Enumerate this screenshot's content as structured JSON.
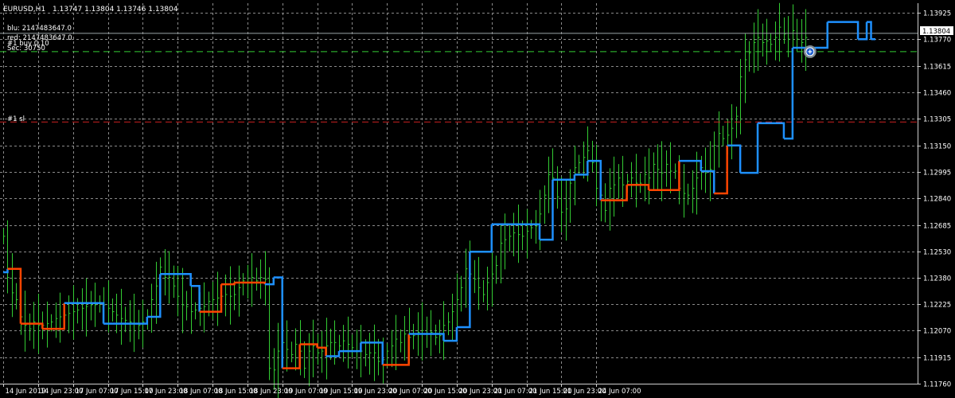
{
  "header": {
    "symbol": "EURUSD,H1",
    "ohlc": "1.13747 1.13804 1.13746 1.13804"
  },
  "indicator_labels": [
    "blu: 2147483647.0",
    "red: 2147483647.0",
    "#1 buy 0.10",
    "Sec: 30750"
  ],
  "sl_label": "#1 sl",
  "current_price_label": "1.13804",
  "colors": {
    "background": "#000000",
    "grid": "#8a8a8a",
    "axis_text": "#ffffff",
    "candle": "#33cc33",
    "step_up": "#1e90ff",
    "step_down": "#ff4500",
    "sl_line": "#cc2020",
    "price_line": "#33cc33",
    "bid_line": "#9aa5a8"
  },
  "chart_data": {
    "type": "line",
    "title": "EURUSD,H1",
    "y_ticks": [
      "1.13925",
      "1.13770",
      "1.13615",
      "1.13460",
      "1.13305",
      "1.13150",
      "1.12995",
      "1.12840",
      "1.12685",
      "1.12530",
      "1.12380",
      "1.12225",
      "1.12070",
      "1.11915",
      "1.11760"
    ],
    "x_ticks": [
      "14 Jun 2019",
      "14 Jun 23:00",
      "17 Jun 07:00",
      "17 Jun 15:00",
      "17 Jun 23:00",
      "18 Jun 07:00",
      "18 Jun 15:00",
      "18 Jun 23:00",
      "19 Jun 07:00",
      "19 Jun 15:00",
      "19 Jun 23:00",
      "20 Jun 07:00",
      "20 Jun 15:00",
      "20 Jun 23:00",
      "21 Jun 07:00",
      "21 Jun 15:00",
      "21 Jun 23:00",
      "24 Jun 07:00"
    ],
    "ylim": [
      1.1176,
      1.1398
    ],
    "grid": true,
    "current_price": 1.13804,
    "sl_price": 1.13287,
    "buy_price": 1.13697,
    "close": [
      1.1262,
      1.1238,
      1.1229,
      1.1225,
      1.1215,
      1.121,
      1.1208,
      1.1212,
      1.121,
      1.121,
      1.1211,
      1.1212,
      1.1214,
      1.1215,
      1.1216,
      1.1217,
      1.1218,
      1.1219,
      1.122,
      1.1221,
      1.1222,
      1.1222,
      1.1223,
      1.1222,
      1.122,
      1.1218,
      1.1216,
      1.1214,
      1.1213,
      1.1212,
      1.1211,
      1.121,
      1.1212,
      1.1215,
      1.1225,
      1.1233,
      1.1244,
      1.1238,
      1.1238,
      1.1233,
      1.1227,
      1.1222,
      1.1221,
      1.1218,
      1.1219,
      1.122,
      1.1221,
      1.1224,
      1.1225,
      1.1226,
      1.1227,
      1.1228,
      1.1227,
      1.1228,
      1.1232,
      1.1236,
      1.1235,
      1.1238,
      1.1236,
      1.1238,
      1.1237,
      1.1185,
      1.1184,
      1.1195,
      1.12,
      1.1196,
      1.1193,
      1.1199,
      1.1195,
      1.1185,
      1.1195,
      1.1198,
      1.1194,
      1.1195,
      1.1198,
      1.12,
      1.12,
      1.1198,
      1.1201,
      1.1199,
      1.1197,
      1.1195,
      1.1195,
      1.1193,
      1.1194,
      1.1194,
      1.1189,
      1.119,
      1.1195,
      1.1198,
      1.1202,
      1.12,
      1.1205,
      1.1203,
      1.1204,
      1.1206,
      1.1207,
      1.1205,
      1.1206,
      1.1203,
      1.1204,
      1.121,
      1.1212,
      1.1218,
      1.1225,
      1.1232,
      1.1243,
      1.124,
      1.1237,
      1.1232,
      1.1228,
      1.1235,
      1.124,
      1.1245,
      1.1258,
      1.126,
      1.1262,
      1.1264,
      1.1263,
      1.1262,
      1.1265,
      1.1267,
      1.1268,
      1.1275,
      1.1286,
      1.1298,
      1.1296,
      1.1285,
      1.1276,
      1.1278,
      1.1293,
      1.1302,
      1.1305,
      1.1308,
      1.1312,
      1.1305,
      1.129,
      1.1286,
      1.1277,
      1.129,
      1.1292,
      1.1296,
      1.1292,
      1.1294,
      1.1296,
      1.1293,
      1.1293,
      1.1298,
      1.1296,
      1.1304,
      1.1301,
      1.1299,
      1.1304,
      1.13,
      1.13,
      1.129,
      1.1287,
      1.1286,
      1.129,
      1.1296,
      1.1302,
      1.1299,
      1.1301,
      1.1315,
      1.1322,
      1.1319,
      1.1321,
      1.1325,
      1.1332,
      1.1355,
      1.1365,
      1.1369,
      1.1375,
      1.1378,
      1.1375,
      1.1376,
      1.1374,
      1.1378,
      1.1384,
      1.138,
      1.1377,
      1.1382,
      1.1377,
      1.1375,
      1.1378
    ],
    "step_segments": [
      {
        "from": 0,
        "to": 1,
        "level": 1.1241,
        "color": "blue"
      },
      {
        "from": 1,
        "to": 4,
        "level": 1.1243,
        "color": "red"
      },
      {
        "from": 4,
        "to": 9,
        "level": 1.1211,
        "color": "red"
      },
      {
        "from": 9,
        "to": 14,
        "level": 1.1208,
        "color": "red"
      },
      {
        "from": 14,
        "to": 23,
        "level": 1.1223,
        "color": "blue"
      },
      {
        "from": 23,
        "to": 33,
        "level": 1.1211,
        "color": "blue"
      },
      {
        "from": 33,
        "to": 36,
        "level": 1.1215,
        "color": "blue"
      },
      {
        "from": 36,
        "to": 43,
        "level": 1.124,
        "color": "blue"
      },
      {
        "from": 43,
        "to": 45,
        "level": 1.1233,
        "color": "blue"
      },
      {
        "from": 45,
        "to": 50,
        "level": 1.1218,
        "color": "red"
      },
      {
        "from": 50,
        "to": 53,
        "level": 1.1234,
        "color": "red"
      },
      {
        "from": 53,
        "to": 60,
        "level": 1.1235,
        "color": "red"
      },
      {
        "from": 60,
        "to": 62,
        "level": 1.1234,
        "color": "blue"
      },
      {
        "from": 62,
        "to": 64,
        "level": 1.1238,
        "color": "blue"
      },
      {
        "from": 64,
        "to": 68,
        "level": 1.1185,
        "color": "red"
      },
      {
        "from": 68,
        "to": 72,
        "level": 1.1199,
        "color": "red"
      },
      {
        "from": 72,
        "to": 74,
        "level": 1.1197,
        "color": "red"
      },
      {
        "from": 74,
        "to": 77,
        "level": 1.1192,
        "color": "blue"
      },
      {
        "from": 77,
        "to": 82,
        "level": 1.1195,
        "color": "blue"
      },
      {
        "from": 82,
        "to": 87,
        "level": 1.12,
        "color": "blue"
      },
      {
        "from": 87,
        "to": 93,
        "level": 1.1187,
        "color": "red"
      },
      {
        "from": 93,
        "to": 101,
        "level": 1.1205,
        "color": "blue"
      },
      {
        "from": 101,
        "to": 104,
        "level": 1.1201,
        "color": "blue"
      },
      {
        "from": 104,
        "to": 107,
        "level": 1.1209,
        "color": "blue"
      },
      {
        "from": 107,
        "to": 112,
        "level": 1.1253,
        "color": "blue"
      },
      {
        "from": 112,
        "to": 123,
        "level": 1.1269,
        "color": "blue"
      },
      {
        "from": 123,
        "to": 126,
        "level": 1.126,
        "color": "blue"
      },
      {
        "from": 126,
        "to": 131,
        "level": 1.1295,
        "color": "blue"
      },
      {
        "from": 131,
        "to": 134,
        "level": 1.1298,
        "color": "blue"
      },
      {
        "from": 134,
        "to": 137,
        "level": 1.1306,
        "color": "blue"
      },
      {
        "from": 137,
        "to": 143,
        "level": 1.1283,
        "color": "red"
      },
      {
        "from": 143,
        "to": 148,
        "level": 1.1292,
        "color": "red"
      },
      {
        "from": 148,
        "to": 155,
        "level": 1.1289,
        "color": "red"
      },
      {
        "from": 155,
        "to": 160,
        "level": 1.1306,
        "color": "blue"
      },
      {
        "from": 160,
        "to": 163,
        "level": 1.13,
        "color": "blue"
      },
      {
        "from": 163,
        "to": 166,
        "level": 1.1287,
        "color": "red"
      },
      {
        "from": 166,
        "to": 169,
        "level": 1.1315,
        "color": "blue"
      },
      {
        "from": 169,
        "to": 173,
        "level": 1.1299,
        "color": "blue"
      },
      {
        "from": 173,
        "to": 179,
        "level": 1.1328,
        "color": "blue"
      },
      {
        "from": 179,
        "to": 181,
        "level": 1.1319,
        "color": "blue"
      },
      {
        "from": 181,
        "to": 189,
        "level": 1.1372,
        "color": "blue"
      },
      {
        "from": 189,
        "to": 196,
        "level": 1.1387,
        "color": "blue"
      },
      {
        "from": 196,
        "to": 198,
        "level": 1.1377,
        "color": "blue"
      },
      {
        "from": 198,
        "to": 199,
        "level": 1.1387,
        "color": "blue"
      },
      {
        "from": 199,
        "to": 200,
        "level": 1.1377,
        "color": "blue"
      }
    ]
  }
}
